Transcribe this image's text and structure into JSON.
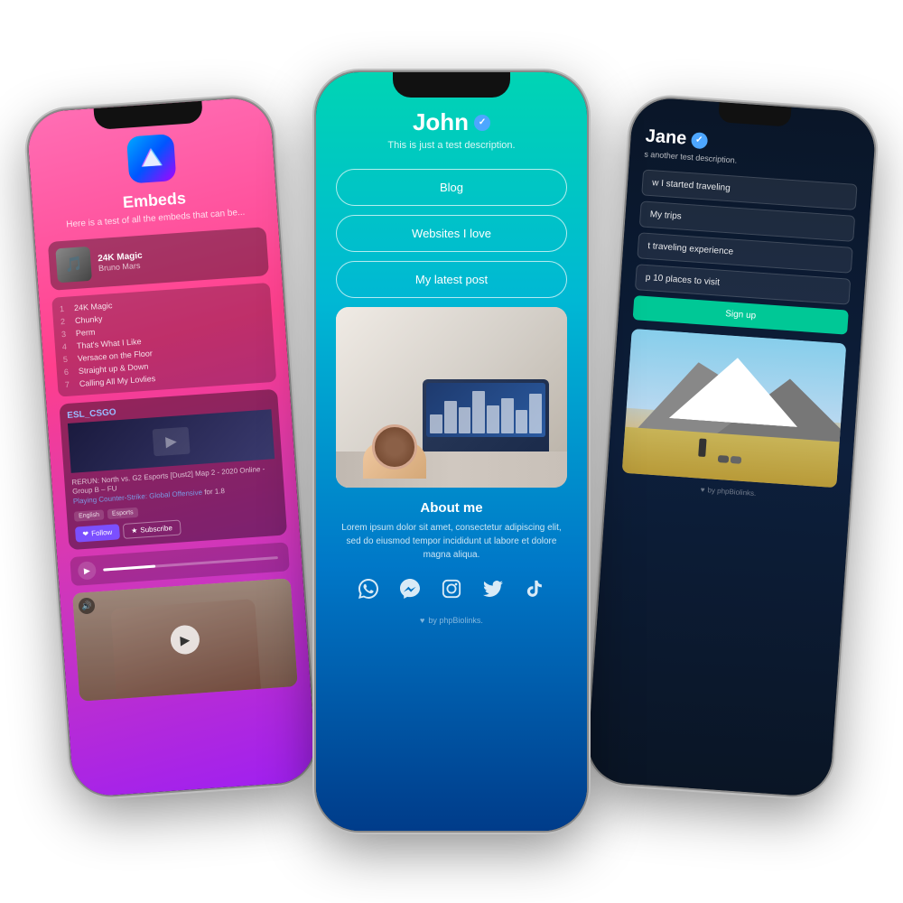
{
  "phones": {
    "left": {
      "title": "Embeds",
      "subtitle": "Here is a test of all the embeds that can be...",
      "music": {
        "title": "24K Magic",
        "artist": "Bruno Mars",
        "tracks": [
          {
            "num": "1",
            "name": "24K Magic"
          },
          {
            "num": "2",
            "name": "Chunky"
          },
          {
            "num": "3",
            "name": "Perm"
          },
          {
            "num": "4",
            "name": "That's What I Like"
          },
          {
            "num": "5",
            "name": "Versace on the Floor"
          },
          {
            "num": "6",
            "name": "Straight up & Down"
          },
          {
            "num": "7",
            "name": "Calling All My Lovlies"
          }
        ]
      },
      "esports": {
        "name": "ESL_CSGO",
        "description": "RERUN: North vs. G2 Esports [Dust2] Map 2 - 2020 Online - Group B - FU",
        "game": "Counter-Strike: Global Offensive",
        "viewers": "for 1.8",
        "tags": [
          "English",
          "Esports"
        ],
        "follow_label": "Follow",
        "subscribe_label": "Subscribe"
      },
      "video": {
        "volume_icon": "🔊"
      }
    },
    "center": {
      "name": "John",
      "verified": true,
      "description": "This is just a test description.",
      "links": [
        {
          "label": "Blog"
        },
        {
          "label": "Websites I love"
        },
        {
          "label": "My latest post"
        }
      ],
      "about_title": "About me",
      "about_text": "Lorem ipsum dolor sit amet, consectetur adipiscing elit, sed do eiusmod tempor incididunt ut labore et dolore magna aliqua.",
      "social_icons": [
        "whatsapp",
        "messenger",
        "instagram",
        "twitter",
        "tiktok"
      ],
      "footer": "by phpBiolinks.",
      "footer_heart": "♥"
    },
    "right": {
      "name": "Jane",
      "verified": true,
      "description": "s another test description.",
      "links": [
        {
          "label": "w I started traveling",
          "active": false
        },
        {
          "label": "My trips",
          "active": false
        },
        {
          "label": "t traveling experience",
          "active": false
        },
        {
          "label": "p 10 places to visit",
          "active": false
        }
      ],
      "signup_label": "Sign up",
      "footer": "by phpBiolinks.",
      "footer_heart": "♥"
    }
  }
}
